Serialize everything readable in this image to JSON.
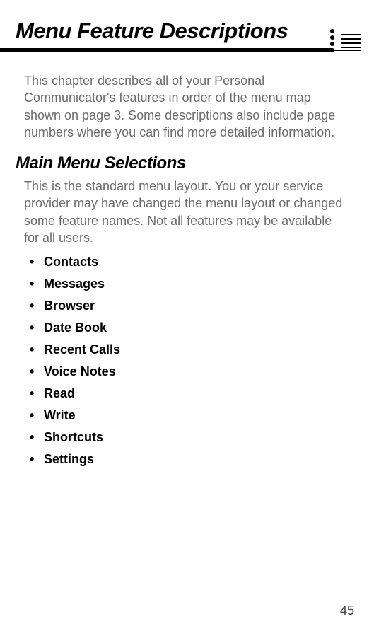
{
  "header": {
    "title": "Menu Feature Descriptions"
  },
  "intro": "This chapter describes all of your Personal Communicator's features in order of the menu map shown on page 3. Some descriptions also include page numbers where you can find more detailed information.",
  "section": {
    "title": "Main Menu Selections",
    "intro": "This is the standard menu layout. You or your service provider may have changed the menu layout or changed some feature names. Not all features may be available for all users."
  },
  "menu_items": [
    "Contacts",
    "Messages",
    "Browser",
    "Date Book",
    "Recent Calls",
    "Voice Notes",
    "Read",
    "Write",
    "Shortcuts",
    "Settings"
  ],
  "page_number": "45"
}
